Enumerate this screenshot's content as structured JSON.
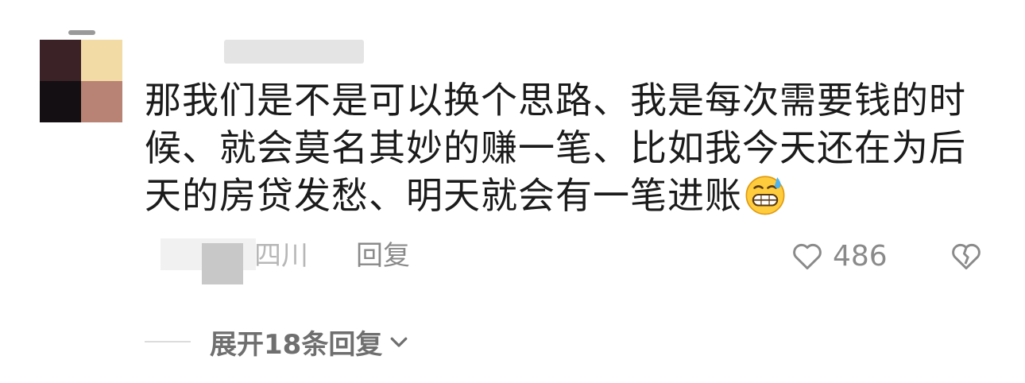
{
  "comment": {
    "text": "那我们是不是可以换个思路、我是每次需要钱的时候、就会莫名其妙的赚一笔、比如我今天还在为后天的房贷发愁、明天就会有一笔进账",
    "emoji": "grinning-sweat-emoji",
    "location": "四川",
    "reply_label": "回复",
    "like_count": "486",
    "avatar_colors": [
      "#3b2226",
      "#f3dba6",
      "#130f12",
      "#b88374"
    ]
  },
  "replies": {
    "expand_label": "展开18条回复"
  },
  "icons": {
    "like": "heart-outline-icon",
    "dislike": "broken-heart-icon",
    "expand": "chevron-down-icon"
  }
}
